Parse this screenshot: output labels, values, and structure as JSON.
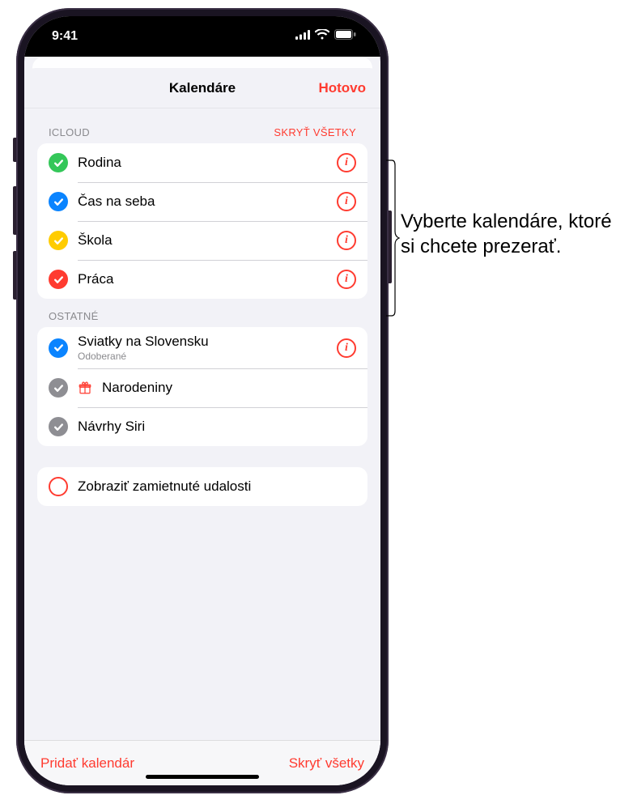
{
  "status": {
    "time": "9:41"
  },
  "header": {
    "title": "Kalendáre",
    "done": "Hotovo"
  },
  "sections": {
    "icloud": {
      "label": "ICLOUD",
      "hide_all": "SKRYŤ VŠETKY",
      "items": [
        {
          "name": "Rodina",
          "color": "#34c759"
        },
        {
          "name": "Čas na seba",
          "color": "#0a84ff"
        },
        {
          "name": "Škola",
          "color": "#ffcc00"
        },
        {
          "name": "Práca",
          "color": "#ff3b30"
        }
      ]
    },
    "other": {
      "label": "OSTATNÉ",
      "items": [
        {
          "name": "Sviatky na Slovensku",
          "sub": "Odoberané",
          "color": "#0a84ff",
          "info": true
        },
        {
          "name": "Narodeniny",
          "icon": "gift",
          "checkcolor": "#8e8e93"
        },
        {
          "name": "Návrhy Siri",
          "checkcolor": "#8e8e93"
        }
      ]
    },
    "declined": {
      "label": "Zobraziť zamietnuté udalosti"
    }
  },
  "footer": {
    "add": "Pridať kalendár",
    "hide_all": "Skryť všetky"
  },
  "annotation": "Vyberte kalendáre, ktoré si chcete prezerať.",
  "colors": {
    "accent": "#ff3b30"
  }
}
